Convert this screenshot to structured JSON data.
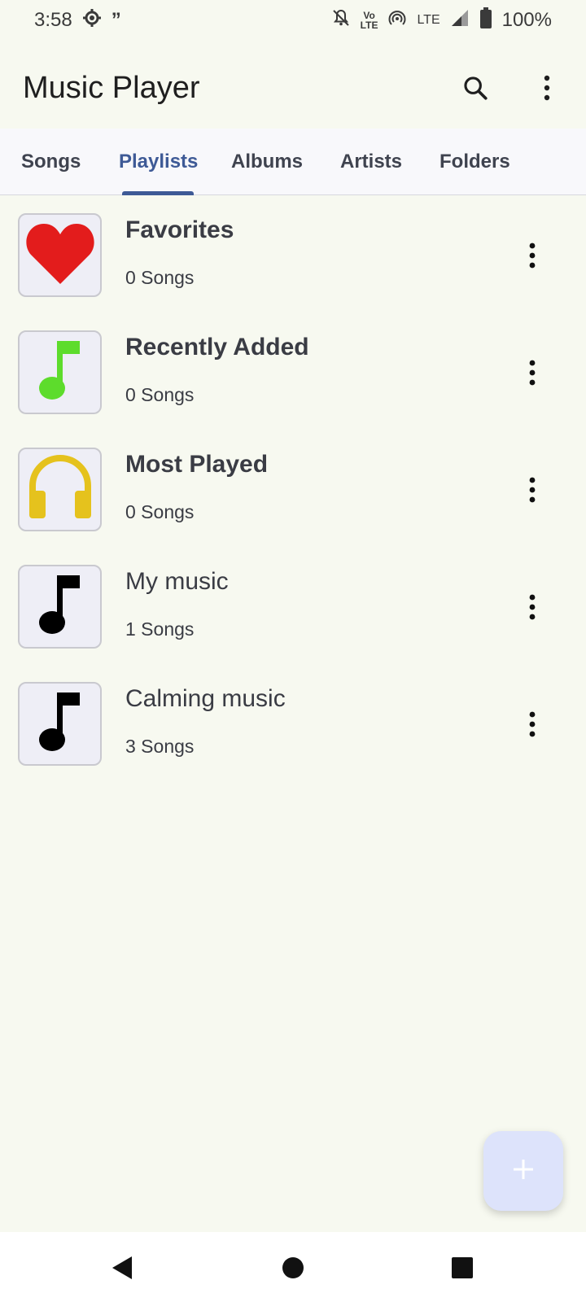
{
  "status_bar": {
    "time": "3:58",
    "volte_top": "Vo",
    "volte_bottom": "LTE",
    "network": "LTE",
    "battery": "100%"
  },
  "app_bar": {
    "title": "Music Player",
    "search_icon": "search-icon",
    "more_icon": "more-vert-icon"
  },
  "tabs": [
    {
      "label": "Songs",
      "active": false
    },
    {
      "label": "Playlists",
      "active": true
    },
    {
      "label": "Albums",
      "active": false
    },
    {
      "label": "Artists",
      "active": false
    },
    {
      "label": "Folders",
      "active": false
    }
  ],
  "playlists": [
    {
      "name": "Favorites",
      "count": "0 Songs",
      "icon": "heart-icon",
      "icon_color": "#e31c1c",
      "bold": true
    },
    {
      "name": "Recently Added",
      "count": "0 Songs",
      "icon": "music-note-icon",
      "icon_color": "#5ddc2c",
      "bold": true
    },
    {
      "name": "Most Played",
      "count": "0 Songs",
      "icon": "headphones-icon",
      "icon_color": "#e5c21d",
      "bold": true
    },
    {
      "name": "My music",
      "count": "1 Songs",
      "icon": "music-note-icon",
      "icon_color": "#000000",
      "bold": false
    },
    {
      "name": "Calming music",
      "count": "3 Songs",
      "icon": "music-note-icon",
      "icon_color": "#000000",
      "bold": false
    }
  ],
  "fab": {
    "icon": "add-icon"
  },
  "colors": {
    "background": "#f7f9f0",
    "accent": "#3e5a96",
    "fab": "#dde3fb"
  }
}
